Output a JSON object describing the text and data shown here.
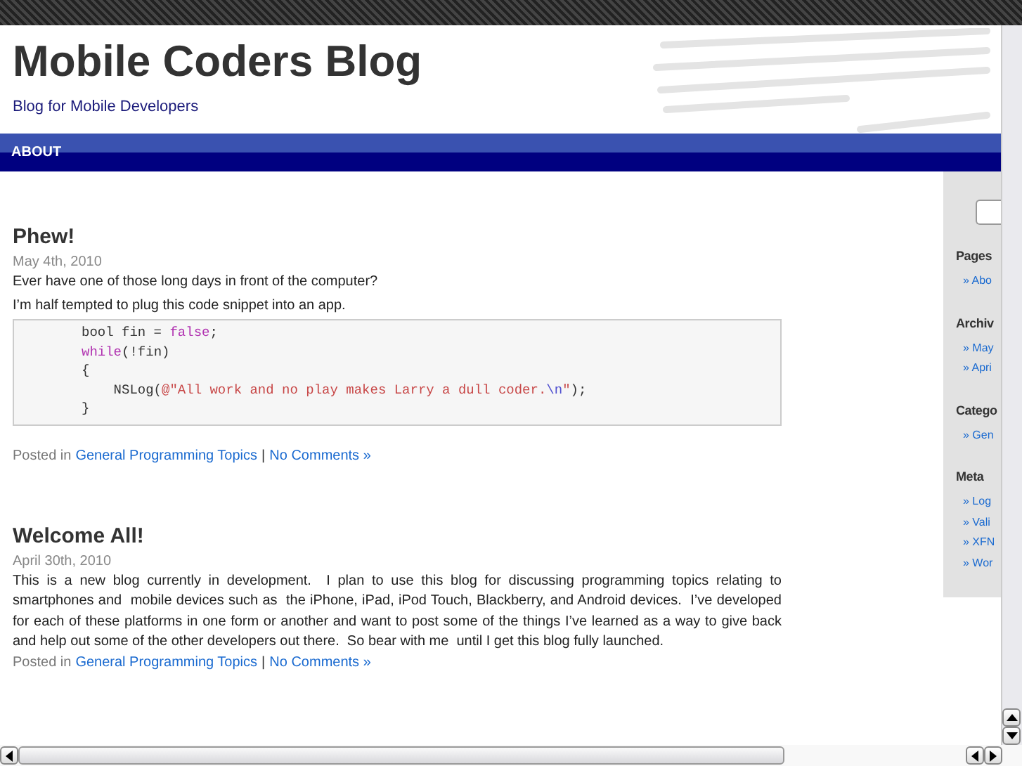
{
  "header": {
    "title": "Mobile Coders Blog",
    "tagline": "Blog for Mobile Developers"
  },
  "nav": {
    "items": [
      {
        "label": "ABOUT"
      }
    ]
  },
  "posts": [
    {
      "title": "Phew!",
      "date": "May 4th, 2010",
      "paragraphs": [
        "Ever have one of those long days in front of the computer?",
        "I’m half tempted to plug this code snippet into an app."
      ],
      "code": [
        [
          {
            "kind": "plain",
            "text": "bool fin = "
          },
          {
            "kind": "keyword",
            "text": "false"
          },
          {
            "kind": "plain",
            "text": ";"
          }
        ],
        [
          {
            "kind": "keyword",
            "text": "while"
          },
          {
            "kind": "plain",
            "text": "(!fin)"
          }
        ],
        [
          {
            "kind": "plain",
            "text": "{"
          }
        ],
        [
          {
            "kind": "plain",
            "text": "    NSLog("
          },
          {
            "kind": "string",
            "text": "@\"All work and no play makes Larry a dull coder."
          },
          {
            "kind": "escape",
            "text": "\\n"
          },
          {
            "kind": "string",
            "text": "\""
          },
          {
            "kind": "plain",
            "text": ");"
          }
        ],
        [
          {
            "kind": "plain",
            "text": "}"
          }
        ]
      ],
      "posted_in": "Posted in",
      "category": "General Programming Topics",
      "separator": "|",
      "comments": "No Comments »"
    },
    {
      "title": "Welcome All!",
      "date": "April 30th, 2010",
      "paragraphs": [
        "This is a new blog currently in development.  I plan to use this blog for discussing programming topics relating to smartphones and  mobile devices such as  the iPhone, iPad, iPod Touch, Blackberry, and Android devices.  I’ve developed for each of these platforms in one form or another and want to post some of the things I’ve learned as a way to give back and help out some of the other developers out there.  So bear with me  until I get this blog fully launched."
      ],
      "posted_in": "Posted in",
      "category": "General Programming Topics",
      "separator": "|",
      "comments": "No Comments »"
    }
  ],
  "sidebar": {
    "sections": [
      {
        "heading": "Pages",
        "links": [
          "» Abo"
        ]
      },
      {
        "heading": "Archiv",
        "links": [
          "» May",
          "» Apri"
        ]
      },
      {
        "heading": "Catego",
        "links": [
          "» Gen"
        ]
      },
      {
        "heading": "Meta",
        "links": [
          "» Log",
          "» Vali",
          "» XFN",
          "» Wor"
        ]
      }
    ]
  }
}
